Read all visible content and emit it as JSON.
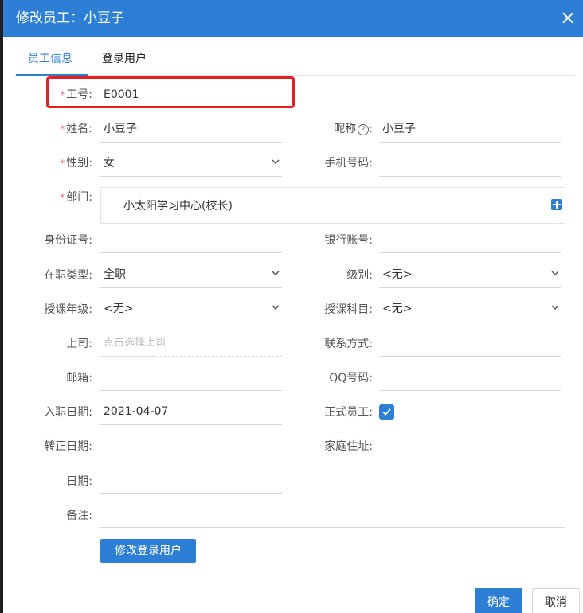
{
  "dialog": {
    "title": "修改员工：小豆子",
    "close_icon": "close-icon"
  },
  "tabs": [
    {
      "label": "员工信息",
      "active": true
    },
    {
      "label": "登录用户",
      "active": false
    }
  ],
  "fields": {
    "employee_no": {
      "label": "工号:",
      "value": "E0001",
      "required": true
    },
    "name": {
      "label": "姓名:",
      "value": "小豆子",
      "required": true
    },
    "nickname": {
      "label": "昵称",
      "value": "小豆子"
    },
    "gender": {
      "label": "性别:",
      "value": "女",
      "required": true
    },
    "phone": {
      "label": "手机号码:",
      "value": ""
    },
    "department": {
      "label": "部门:",
      "value": "小太阳学习中心(校长)",
      "required": true
    },
    "id_card": {
      "label": "身份证号:",
      "value": ""
    },
    "bank_account": {
      "label": "银行账号:",
      "value": ""
    },
    "employment_type": {
      "label": "在职类型:",
      "value": "全职"
    },
    "level": {
      "label": "级别:",
      "value": "<无>"
    },
    "teaching_grade": {
      "label": "授课年级:",
      "value": "<无>"
    },
    "teaching_subject": {
      "label": "授课科目:",
      "value": "<无>"
    },
    "superior": {
      "label": "上司:",
      "value": "",
      "placeholder": "点击选择上司"
    },
    "contact": {
      "label": "联系方式:",
      "value": ""
    },
    "email": {
      "label": "邮箱:",
      "value": ""
    },
    "qq": {
      "label": "QQ号码:",
      "value": ""
    },
    "hire_date": {
      "label": "入职日期:",
      "value": "2021-04-07"
    },
    "regular_employee": {
      "label": "正式员工:",
      "checked": true
    },
    "regularization_date": {
      "label": "转正日期:",
      "value": ""
    },
    "home_address": {
      "label": "家庭住址:",
      "value": ""
    },
    "date": {
      "label": "日期:",
      "value": ""
    },
    "remark": {
      "label": "备注:",
      "value": ""
    }
  },
  "buttons": {
    "edit_login_user": "修改登录用户",
    "ok": "确定",
    "cancel": "取消"
  },
  "colors": {
    "accent": "#2d7fd6",
    "required": "#f56c6c",
    "highlight": "#e62020"
  }
}
